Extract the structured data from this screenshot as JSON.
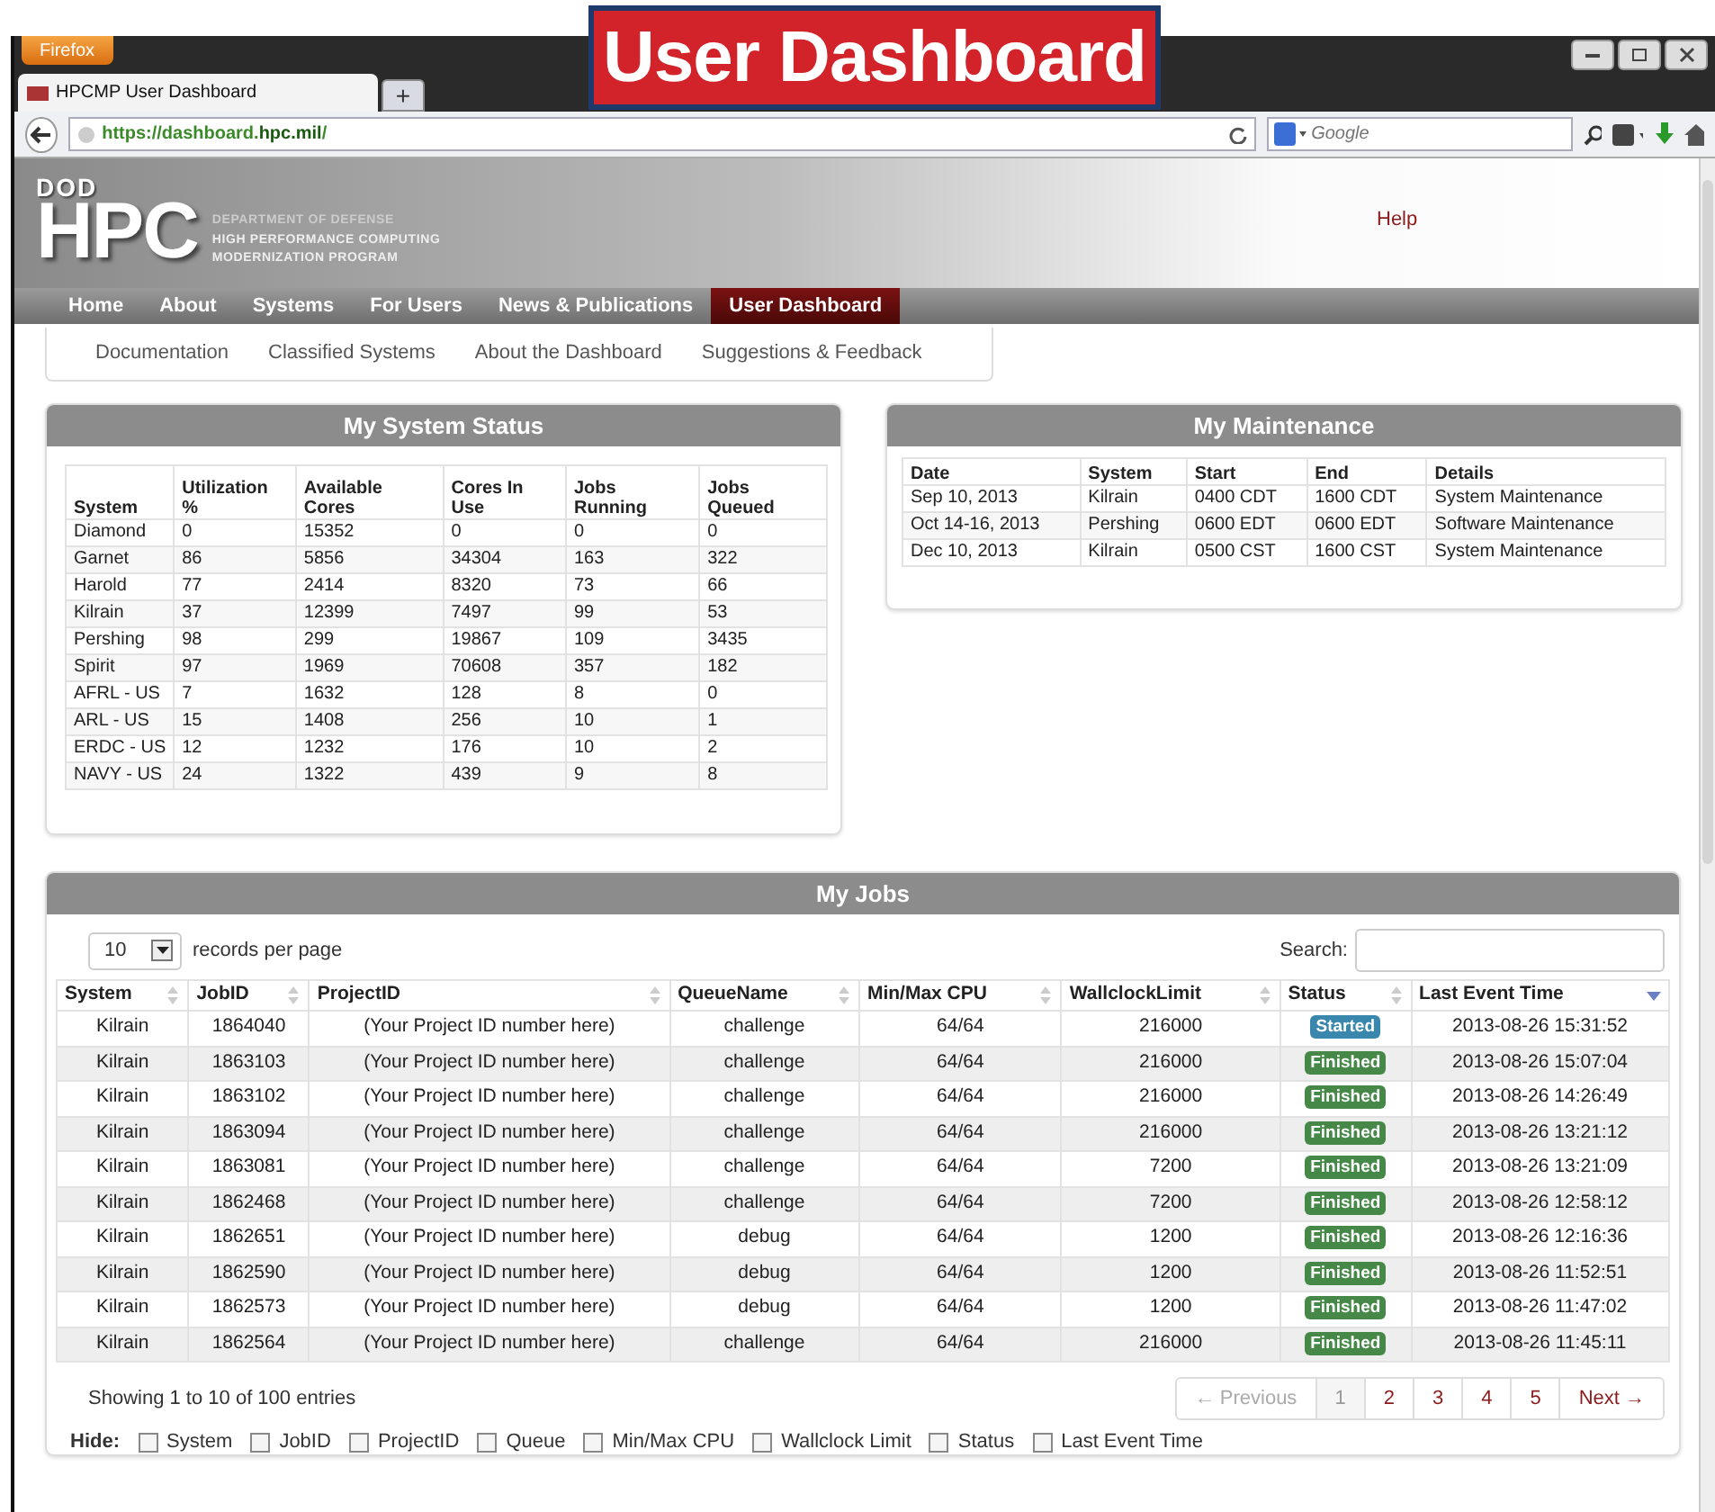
{
  "overlay_title": "User Dashboard",
  "browser": {
    "menu_button": "Firefox",
    "tab_title": "HPCMP User Dashboard",
    "new_tab": "+",
    "url": "https://dashboard.**hpc.mil**/",
    "search_placeholder": "Google"
  },
  "header": {
    "logo_top": "DOD",
    "logo_main": "HPC",
    "logo_lines": [
      "DEPARTMENT OF DEFENSE",
      "HIGH PERFORMANCE COMPUTING",
      "MODERNIZATION PROGRAM"
    ],
    "help": "Help"
  },
  "nav": [
    {
      "label": "Home",
      "selected": false
    },
    {
      "label": "About",
      "selected": false
    },
    {
      "label": "Systems",
      "selected": false
    },
    {
      "label": "For Users",
      "selected": false
    },
    {
      "label": "News & Publications",
      "selected": false
    },
    {
      "label": "User Dashboard",
      "selected": true
    }
  ],
  "subnav": [
    "Documentation",
    "Classified Systems",
    "About the Dashboard",
    "Suggestions & Feedback"
  ],
  "system_status": {
    "title": "My System Status",
    "columns": [
      "System",
      "Utilization %",
      "Available Cores",
      "Cores In Use",
      "Jobs Running",
      "Jobs Queued"
    ],
    "rows": [
      [
        "Diamond",
        "0",
        "15352",
        "0",
        "0",
        "0"
      ],
      [
        "Garnet",
        "86",
        "5856",
        "34304",
        "163",
        "322"
      ],
      [
        "Harold",
        "77",
        "2414",
        "8320",
        "73",
        "66"
      ],
      [
        "Kilrain",
        "37",
        "12399",
        "7497",
        "99",
        "53"
      ],
      [
        "Pershing",
        "98",
        "299",
        "19867",
        "109",
        "3435"
      ],
      [
        "Spirit",
        "97",
        "1969",
        "70608",
        "357",
        "182"
      ],
      [
        "AFRL - US",
        "7",
        "1632",
        "128",
        "8",
        "0"
      ],
      [
        "ARL - US",
        "15",
        "1408",
        "256",
        "10",
        "1"
      ],
      [
        "ERDC - US",
        "12",
        "1232",
        "176",
        "10",
        "2"
      ],
      [
        "NAVY - US",
        "24",
        "1322",
        "439",
        "9",
        "8"
      ]
    ]
  },
  "maintenance": {
    "title": "My Maintenance",
    "columns": [
      "Date",
      "System",
      "Start",
      "End",
      "Details"
    ],
    "rows": [
      [
        "Sep 10, 2013",
        "Kilrain",
        "0400 CDT",
        "1600 CDT",
        "System Maintenance"
      ],
      [
        "Oct 14-16, 2013",
        "Pershing",
        "0600 EDT",
        "0600 EDT",
        "Software Maintenance"
      ],
      [
        "Dec 10, 2013",
        "Kilrain",
        "0500 CST",
        "1600 CST",
        "System Maintenance"
      ]
    ]
  },
  "jobs": {
    "title": "My Jobs",
    "page_size": "10",
    "page_size_label": "records per page",
    "search_label": "Search:",
    "columns": [
      {
        "label": "System",
        "sorted": false
      },
      {
        "label": "JobID",
        "sorted": false
      },
      {
        "label": "ProjectID",
        "sorted": false
      },
      {
        "label": "QueueName",
        "sorted": false
      },
      {
        "label": "Min/Max CPU",
        "sorted": false
      },
      {
        "label": "WallclockLimit",
        "sorted": false
      },
      {
        "label": "Status",
        "sorted": false
      },
      {
        "label": "Last Event Time",
        "sorted": true
      }
    ],
    "rows": [
      {
        "system": "Kilrain",
        "job_id": "1864040",
        "project_id": "(Your Project ID number here)",
        "queue": "challenge",
        "cpu": "64/64",
        "wallclock": "216000",
        "status": "Started",
        "color": "#3a87ad",
        "last_event": "2013-08-26 15:31:52"
      },
      {
        "system": "Kilrain",
        "job_id": "1863103",
        "project_id": "(Your Project ID number here)",
        "queue": "challenge",
        "cpu": "64/64",
        "wallclock": "216000",
        "status": "Finished",
        "color": "#468847",
        "last_event": "2013-08-26 15:07:04"
      },
      {
        "system": "Kilrain",
        "job_id": "1863102",
        "project_id": "(Your Project ID number here)",
        "queue": "challenge",
        "cpu": "64/64",
        "wallclock": "216000",
        "status": "Finished",
        "color": "#468847",
        "last_event": "2013-08-26 14:26:49"
      },
      {
        "system": "Kilrain",
        "job_id": "1863094",
        "project_id": "(Your Project ID number here)",
        "queue": "challenge",
        "cpu": "64/64",
        "wallclock": "216000",
        "status": "Finished",
        "color": "#468847",
        "last_event": "2013-08-26 13:21:12"
      },
      {
        "system": "Kilrain",
        "job_id": "1863081",
        "project_id": "(Your Project ID number here)",
        "queue": "challenge",
        "cpu": "64/64",
        "wallclock": "7200",
        "status": "Finished",
        "color": "#468847",
        "last_event": "2013-08-26 13:21:09"
      },
      {
        "system": "Kilrain",
        "job_id": "1862468",
        "project_id": "(Your Project ID number here)",
        "queue": "challenge",
        "cpu": "64/64",
        "wallclock": "7200",
        "status": "Finished",
        "color": "#468847",
        "last_event": "2013-08-26 12:58:12"
      },
      {
        "system": "Kilrain",
        "job_id": "1862651",
        "project_id": "(Your Project ID number here)",
        "queue": "debug",
        "cpu": "64/64",
        "wallclock": "1200",
        "status": "Finished",
        "color": "#468847",
        "last_event": "2013-08-26 12:16:36"
      },
      {
        "system": "Kilrain",
        "job_id": "1862590",
        "project_id": "(Your Project ID number here)",
        "queue": "debug",
        "cpu": "64/64",
        "wallclock": "1200",
        "status": "Finished",
        "color": "#468847",
        "last_event": "2013-08-26 11:52:51"
      },
      {
        "system": "Kilrain",
        "job_id": "1862573",
        "project_id": "(Your Project ID number here)",
        "queue": "debug",
        "cpu": "64/64",
        "wallclock": "1200",
        "status": "Finished",
        "color": "#468847",
        "last_event": "2013-08-26 11:47:02"
      },
      {
        "system": "Kilrain",
        "job_id": "1862564",
        "project_id": "(Your Project ID number here)",
        "queue": "challenge",
        "cpu": "64/64",
        "wallclock": "216000",
        "status": "Finished",
        "color": "#468847",
        "last_event": "2013-08-26 11:45:11"
      }
    ],
    "info": "Showing 1 to 10 of 100 entries",
    "pagination": {
      "previous": {
        "label": "← Previous",
        "disabled": true
      },
      "pages": [
        {
          "label": "1",
          "selected": true
        },
        {
          "label": "2",
          "selected": false
        },
        {
          "label": "3",
          "selected": false
        },
        {
          "label": "4",
          "selected": false
        },
        {
          "label": "5",
          "selected": false
        }
      ],
      "next": {
        "label": "Next →",
        "disabled": false
      }
    },
    "hide": {
      "label": "Hide:",
      "options": [
        {
          "label": "System",
          "checked": false
        },
        {
          "label": "JobID",
          "checked": false
        },
        {
          "label": "ProjectID",
          "checked": false
        },
        {
          "label": "Queue",
          "checked": false
        },
        {
          "label": "Min/Max CPU",
          "checked": false
        },
        {
          "label": "Wallclock Limit",
          "checked": false
        },
        {
          "label": "Status",
          "checked": false
        },
        {
          "label": "Last Event Time",
          "checked": false
        }
      ]
    }
  }
}
